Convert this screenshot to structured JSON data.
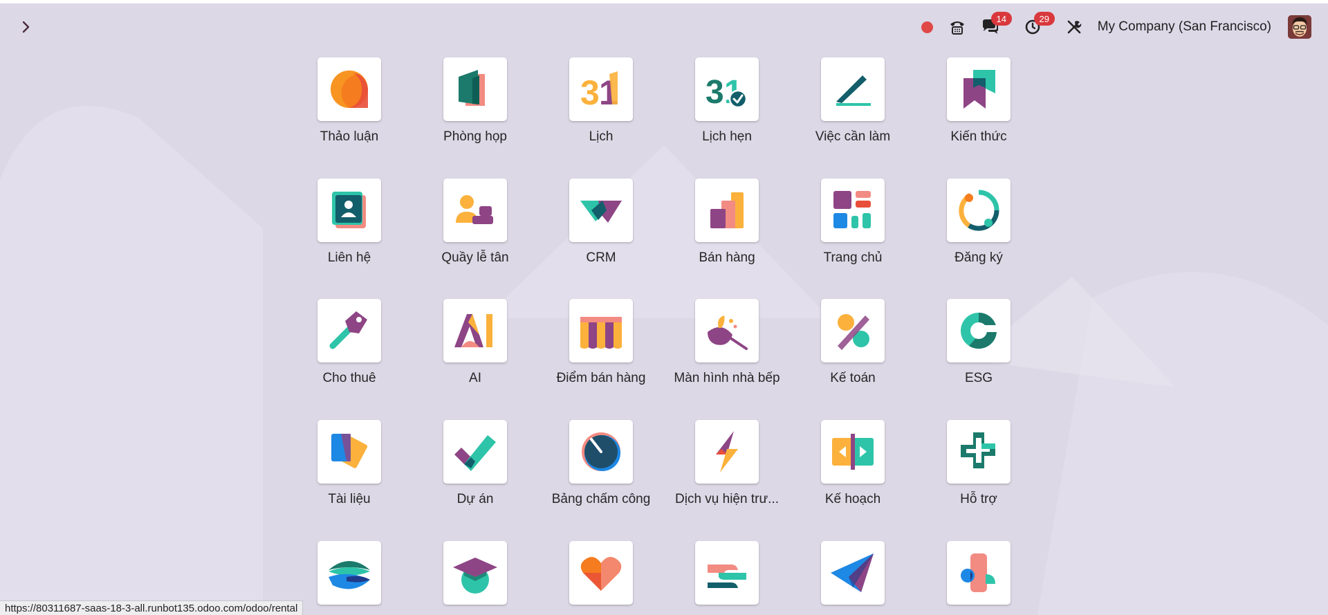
{
  "navbar": {
    "company": "My Company (San Francisco)",
    "messages_badge": "14",
    "activities_badge": "29"
  },
  "apps": [
    {
      "label": "Thảo luận",
      "icon": "discuss-icon"
    },
    {
      "label": "Phòng họp",
      "icon": "meeting-room-icon"
    },
    {
      "label": "Lịch",
      "icon": "calendar-icon"
    },
    {
      "label": "Lịch hẹn",
      "icon": "appointment-icon"
    },
    {
      "label": "Việc cần làm",
      "icon": "todo-icon"
    },
    {
      "label": "Kiến thức",
      "icon": "knowledge-icon"
    },
    {
      "label": "Liên hệ",
      "icon": "contacts-icon"
    },
    {
      "label": "Quầy lễ tân",
      "icon": "frontdesk-icon"
    },
    {
      "label": "CRM",
      "icon": "crm-icon"
    },
    {
      "label": "Bán hàng",
      "icon": "sales-icon"
    },
    {
      "label": "Trang chủ",
      "icon": "dashboards-icon"
    },
    {
      "label": "Đăng ký",
      "icon": "subscriptions-icon"
    },
    {
      "label": "Cho thuê",
      "icon": "rental-icon"
    },
    {
      "label": "AI",
      "icon": "ai-icon"
    },
    {
      "label": "Điểm bán hàng",
      "icon": "point-of-sale-icon"
    },
    {
      "label": "Màn hình nhà bếp",
      "icon": "kitchen-display-icon"
    },
    {
      "label": "Kế toán",
      "icon": "accounting-icon"
    },
    {
      "label": "ESG",
      "icon": "esg-icon"
    },
    {
      "label": "Tài liệu",
      "icon": "documents-icon"
    },
    {
      "label": "Dự án",
      "icon": "project-icon"
    },
    {
      "label": "Bảng chấm công",
      "icon": "timesheets-icon"
    },
    {
      "label": "Dịch vụ hiện trư...",
      "icon": "field-service-icon"
    },
    {
      "label": "Kế hoạch",
      "icon": "planning-icon"
    },
    {
      "label": "Hỗ trợ",
      "icon": "helpdesk-icon"
    },
    {
      "label": "",
      "icon": "website-icon"
    },
    {
      "label": "",
      "icon": "elearning-icon"
    },
    {
      "label": "",
      "icon": "appraisal-icon"
    },
    {
      "label": "",
      "icon": "referral-icon"
    },
    {
      "label": "",
      "icon": "email-marketing-icon"
    },
    {
      "label": "",
      "icon": "marketing-automation-icon"
    }
  ],
  "statusbar": {
    "url": "https://80311687-saas-18-3-all.runbot135.odoo.com/odoo/rental"
  }
}
